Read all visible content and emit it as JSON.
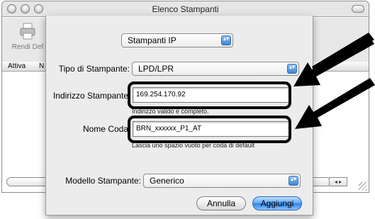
{
  "window": {
    "title": "Elenco Stampanti",
    "toolbar_item_label": "Rendi Def",
    "list_columns": [
      "Attiva",
      "N"
    ],
    "scroll_arrows": "◂ ▸"
  },
  "sheet": {
    "connection_popup": "Stampanti IP",
    "printer_type_label": "Tipo di Stampante:",
    "printer_type_value": "LPD/LPR",
    "address_label": "Indirizzo Stampante",
    "address_value": "169.254.170.92",
    "address_hint": "Indirizzo valido e completo.",
    "queue_label": "Nome Coda",
    "queue_value": "BRN_xxxxxx_P1_AT",
    "queue_hint": "Lascia uno spazio vuoto per coda di default",
    "model_label": "Modello Stampante:",
    "model_value": "Generico",
    "cancel_label": "Annulla",
    "add_label": "Aggiungi"
  },
  "popup_arrows_glyph": "▴▾",
  "colors": {
    "default_button": "#3c8ae6",
    "annotation": "#000000"
  }
}
